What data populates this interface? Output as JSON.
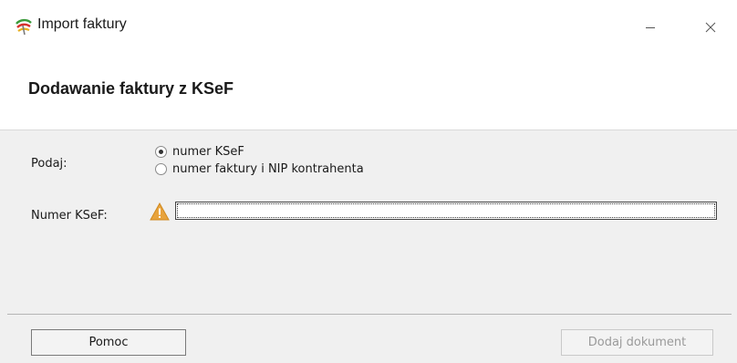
{
  "window": {
    "title": "Import faktury",
    "minimize_label": "—",
    "close_label": "✕",
    "app_icon": "ksef-app-icon"
  },
  "header": {
    "title": "Dodawanie faktury z KSeF"
  },
  "form": {
    "podaj_label": "Podaj:",
    "radio_options": [
      {
        "label": "numer KSeF",
        "checked": true
      },
      {
        "label": "numer faktury i NIP kontrahenta",
        "checked": false
      }
    ],
    "numer_ksef_label": "Numer KSeF:",
    "numer_ksef_value": "",
    "warning_icon": "warning-triangle-icon",
    "warning_color": "#e8a33c"
  },
  "footer": {
    "help_label": "Pomoc",
    "add_label": "Dodaj dokument",
    "add_enabled": false
  }
}
